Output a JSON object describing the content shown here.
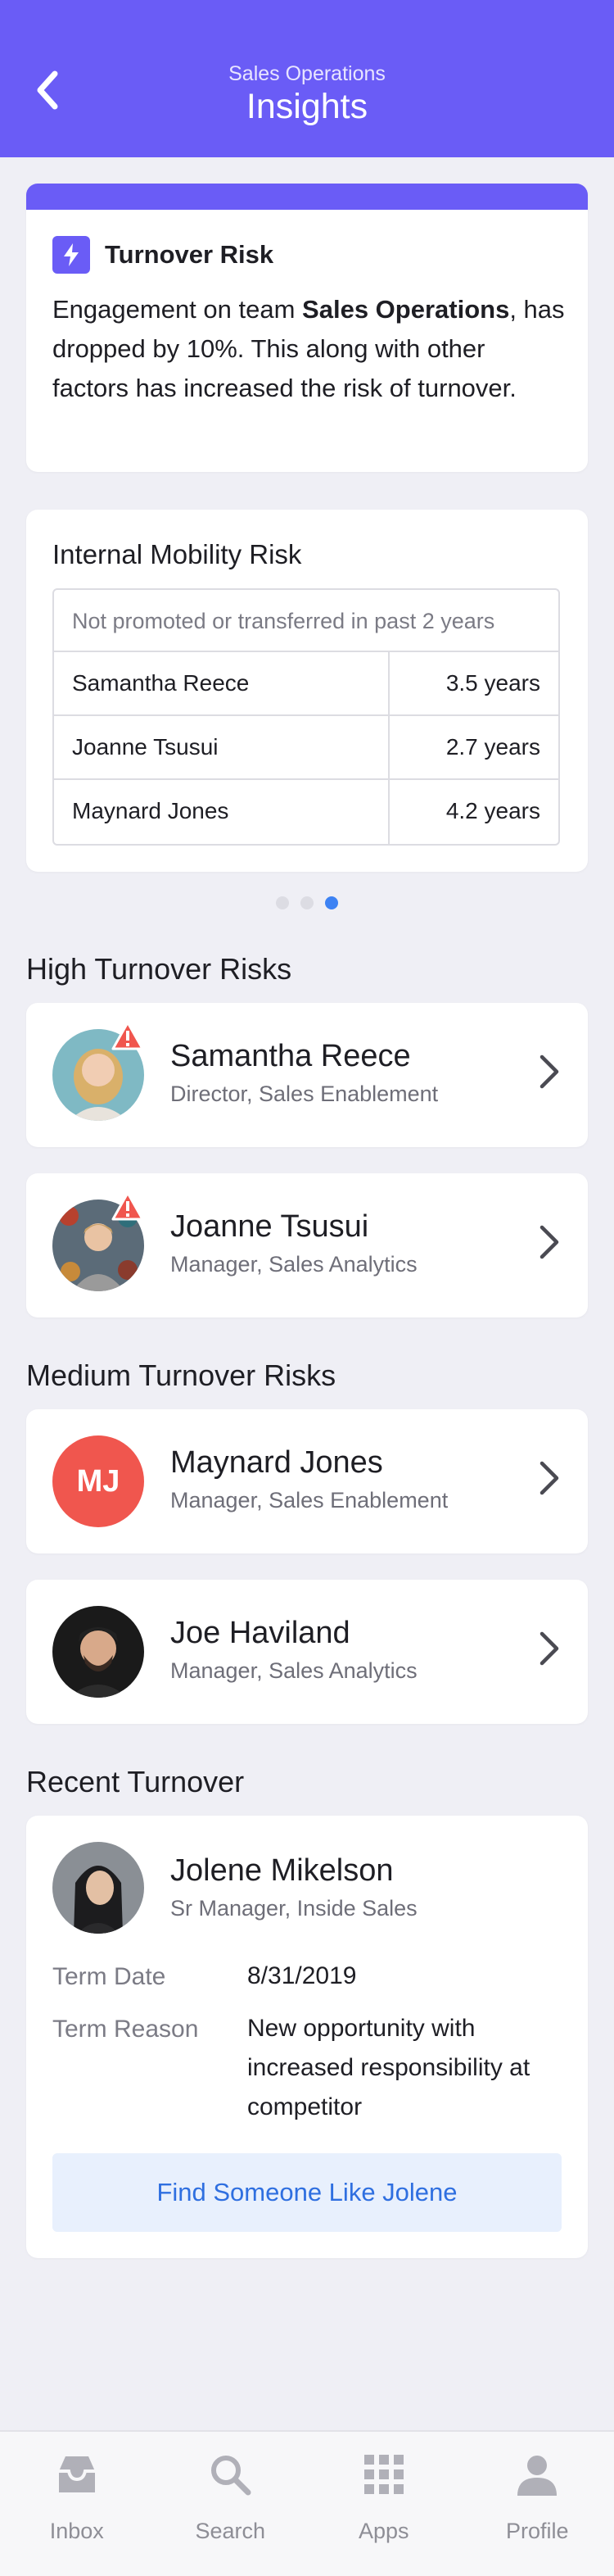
{
  "header": {
    "subtitle": "Sales Operations",
    "title": "Insights",
    "back_icon": "chevron-left-icon"
  },
  "turnover_card": {
    "icon": "bolt-icon",
    "title": "Turnover Risk",
    "text_before": "Engagement on team ",
    "team": "Sales Operations",
    "text_after": ", has dropped by 10%. This along with other factors has increased the risk of turnover."
  },
  "mobility_card": {
    "title": "Internal Mobility Risk",
    "caption": "Not promoted or transferred in past 2 years",
    "rows": [
      {
        "name": "Samantha Reece",
        "value": "3.5 years"
      },
      {
        "name": "Joanne Tsusui",
        "value": "2.7 years"
      },
      {
        "name": "Maynard Jones",
        "value": "4.2 years"
      }
    ]
  },
  "carousel": {
    "page_count": 3,
    "active_index": 2
  },
  "high_risks": {
    "title": "High Turnover Risks",
    "people": [
      {
        "name": "Samantha Reece",
        "role": "Director, Sales Enablement",
        "warning": true,
        "avatar_color": "#7fb9c4"
      },
      {
        "name": "Joanne Tsusui",
        "role": "Manager, Sales Analytics",
        "warning": true,
        "avatar_color": "#5b6b78"
      }
    ]
  },
  "medium_risks": {
    "title": "Medium Turnover Risks",
    "people": [
      {
        "name": "Maynard Jones",
        "role": "Manager, Sales Enablement",
        "initials": "MJ",
        "avatar_color": "#f0564e"
      },
      {
        "name": "Joe Haviland",
        "role": "Manager, Sales Analytics",
        "avatar_color": "#1a1a1a"
      }
    ]
  },
  "recent": {
    "title": "Recent Turnover",
    "name": "Jolene Mikelson",
    "role": "Sr Manager, Inside Sales",
    "term_date_label": "Term Date",
    "term_date": "8/31/2019",
    "term_reason_label": "Term Reason",
    "term_reason": "New opportunity with increased responsibility at competitor",
    "button": "Find Someone Like Jolene"
  },
  "tabs": [
    {
      "label": "Inbox",
      "icon": "inbox-icon"
    },
    {
      "label": "Search",
      "icon": "search-icon"
    },
    {
      "label": "Apps",
      "icon": "apps-grid-icon"
    },
    {
      "label": "Profile",
      "icon": "profile-icon"
    }
  ],
  "colors": {
    "brand": "#6a5cf6",
    "link": "#2f6fe0",
    "warning": "#f0564e",
    "active_dot": "#3d82f3"
  }
}
